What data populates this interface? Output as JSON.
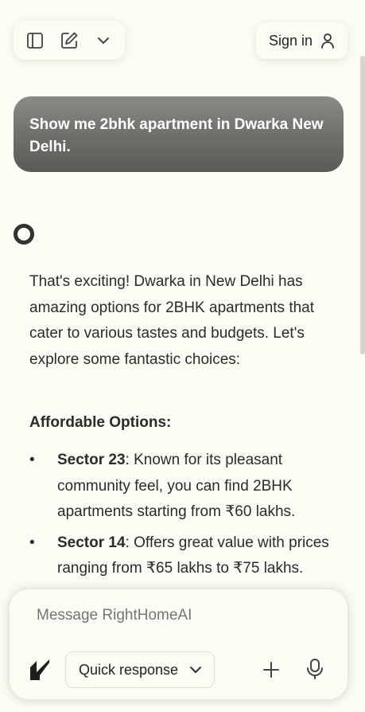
{
  "topbar": {
    "sign_in_label": "Sign in"
  },
  "chat": {
    "user_message": "Show me 2bhk apartment in Dwarka New Delhi.",
    "assistant_intro": "That's exciting! Dwarka in New Delhi has amazing options for 2BHK apartments that cater to various tastes and budgets. Let's explore some fantastic choices:",
    "section_title": "Affordable Options:",
    "bullets": [
      {
        "name": "Sector 23",
        "text": ": Known for its pleasant community feel, you can find 2BHK apartments starting from ₹60 lakhs."
      },
      {
        "name": "Sector 14",
        "text": ": Offers great value with prices ranging from ₹65 lakhs to ₹75 lakhs."
      }
    ]
  },
  "composer": {
    "placeholder": "Message RightHomeAI",
    "mode_label": "Quick response"
  },
  "icons": {
    "sidebar": "sidebar-toggle-icon",
    "new_chat": "edit-icon",
    "dropdown": "chevron-down-icon",
    "user": "user-icon",
    "logo": "righthome-logo-icon",
    "plus": "plus-icon",
    "mic": "microphone-icon"
  }
}
